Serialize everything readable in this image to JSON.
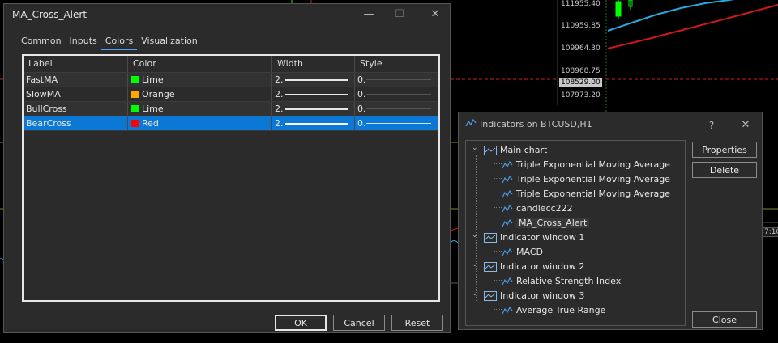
{
  "chart": {
    "price_labels": [
      "111955.40",
      "110959.85",
      "109964.30",
      "108968.75",
      "108529.00",
      "107973.20"
    ],
    "current_price": "108529.00",
    "time_label": "7:10"
  },
  "props_dialog": {
    "title": "MA_Cross_Alert",
    "tabs": [
      "Common",
      "Inputs",
      "Colors",
      "Visualization"
    ],
    "active_tab": "Colors",
    "columns": [
      "Label",
      "Color",
      "Width",
      "Style"
    ],
    "rows": [
      {
        "label": "FastMA",
        "color_name": "Lime",
        "color_hex": "#00ff00",
        "width": "2.",
        "style": "0."
      },
      {
        "label": "SlowMA",
        "color_name": "Orange",
        "color_hex": "#ffa500",
        "width": "2.",
        "style": "0."
      },
      {
        "label": "BullCross",
        "color_name": "Lime",
        "color_hex": "#00ff00",
        "width": "2.",
        "style": "0."
      },
      {
        "label": "BearCross",
        "color_name": "Red",
        "color_hex": "#ff0000",
        "width": "2.",
        "style": "0."
      }
    ],
    "selected_row": "BearCross",
    "buttons": {
      "ok": "OK",
      "cancel": "Cancel",
      "reset": "Reset"
    },
    "window_controls": {
      "minimize": "—",
      "maximize": "☐",
      "close": "✕"
    }
  },
  "indicators_dialog": {
    "title": "Indicators on BTCUSD,H1",
    "help": "?",
    "close_glyph": "✕",
    "buttons": {
      "properties": "Properties",
      "delete": "Delete",
      "close": "Close"
    },
    "tree": {
      "main_chart": "Main chart",
      "main_items": [
        "Triple Exponential Moving Average",
        "Triple Exponential Moving Average",
        "Triple Exponential Moving Average",
        "candlecc222",
        "MA_Cross_Alert"
      ],
      "selected_item": "MA_Cross_Alert",
      "window1": "Indicator window 1",
      "window1_items": [
        "MACD"
      ],
      "window2": "Indicator window 2",
      "window2_items": [
        "Relative Strength Index"
      ],
      "window3": "Indicator window 3",
      "window3_items": [
        "Average True Range"
      ]
    }
  },
  "colors": {
    "accent": "#0a78d4",
    "dialog_bg": "#2b2b2b",
    "chart_bg": "#000000"
  }
}
